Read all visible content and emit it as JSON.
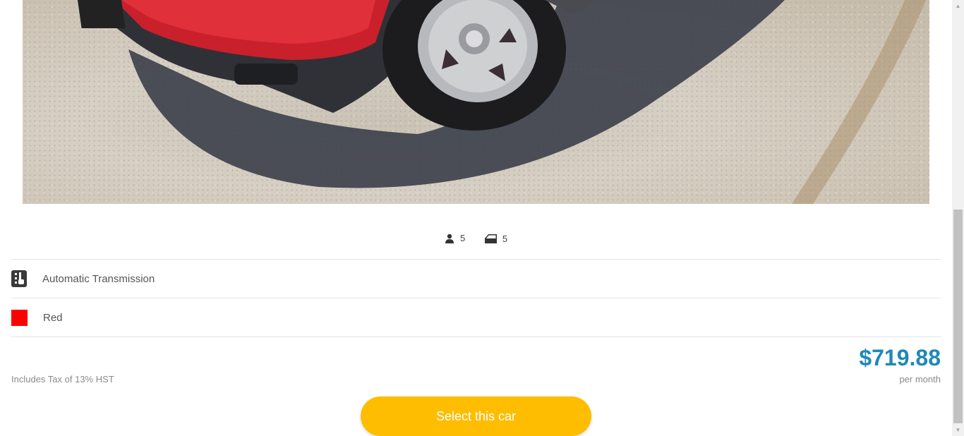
{
  "vehicle": {
    "photo_alt": "Red SUV front wheel",
    "passengers": "5",
    "doors": "5",
    "transmission": "Automatic Transmission",
    "color_label": "Red",
    "color_swatch": "#ff0000"
  },
  "pricing": {
    "tax_note": "Includes Tax of 13% HST",
    "price": "$719.88",
    "period": "per month"
  },
  "actions": {
    "select_label": "Select this car"
  },
  "colors": {
    "accent_price": "#1f88b8",
    "button_bg": "#ffbd00"
  },
  "icons": {
    "passengers": "person-icon",
    "doors": "car-door-icon",
    "transmission": "gear-shift-icon",
    "scroll_up": "arrow-up-icon",
    "scroll_down": "arrow-down-icon"
  }
}
